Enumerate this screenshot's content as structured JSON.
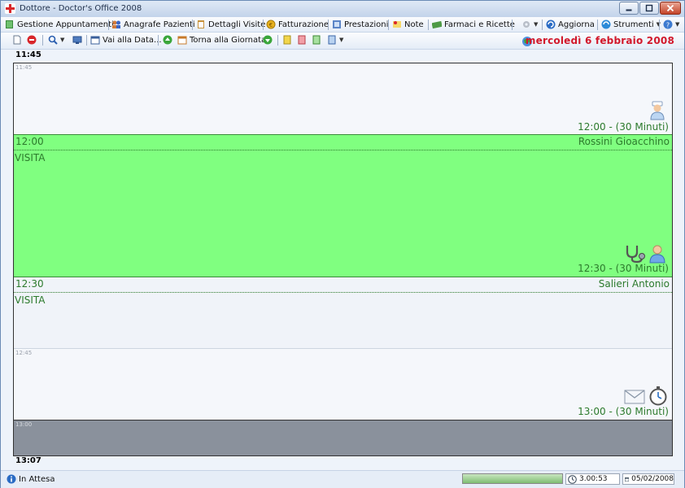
{
  "window": {
    "title": "Dottore - Doctor's Office 2008"
  },
  "menu": {
    "items": [
      {
        "label": "Gestione Appuntamenti",
        "icon": "book-icon"
      },
      {
        "label": "Anagrafe Pazienti",
        "icon": "people-icon"
      },
      {
        "label": "Dettagli Visite",
        "icon": "clipboard-icon"
      },
      {
        "label": "Fatturazione",
        "icon": "coin-icon"
      },
      {
        "label": "Prestazioni",
        "icon": "services-icon"
      },
      {
        "label": "Note",
        "icon": "note-icon"
      },
      {
        "label": "Farmaci e Ricette",
        "icon": "money-icon"
      },
      {
        "label": "Aggiorna",
        "icon": "update-icon"
      },
      {
        "label": "Strumenti",
        "icon": "tools-icon"
      }
    ]
  },
  "toolbar": {
    "goto_date": "Vai alla Data...",
    "back_to_day": "Torna alla Giornata",
    "current_date": "mercoledì 6 febbraio 2008"
  },
  "calendar": {
    "start_time": "11:45",
    "end_time": "13:07",
    "slot_labels": {
      "s1145": "11:45",
      "s1245": "12:45",
      "s1300": "13:00"
    },
    "footers": {
      "f1200": "12:00 - (30 Minuti)",
      "f1230": "12:30 - (30 Minuti)",
      "f1300": "13:00 - (30 Minuti)"
    },
    "appointments": [
      {
        "time": "12:00",
        "patient": "Rossini Gioacchino",
        "type": "VISITA",
        "color": "#80ff80"
      },
      {
        "time": "12:30",
        "patient": "Salieri Antonio",
        "type": "VISITA",
        "color": "#f0f3f9"
      }
    ],
    "accent_color": "#2c7a2c"
  },
  "status": {
    "text": "In Attesa",
    "progress": 1.0,
    "timer": "3.00:53",
    "date": "05/02/2008"
  }
}
